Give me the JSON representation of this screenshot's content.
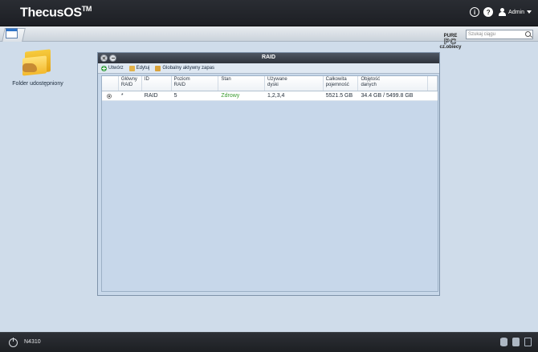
{
  "topbar": {
    "brand": "ThecusOS",
    "brand_mark": "TM",
    "user_label": "Admin",
    "info_glyph": "i",
    "help_glyph": "?"
  },
  "desktop": {
    "items": [
      {
        "label": "Folder udostępniony",
        "icon": "shared-folder-icon"
      }
    ]
  },
  "search": {
    "placeholder": "Szukaj ciągu"
  },
  "watermark": {
    "line1": "PURE",
    "line2": "PC",
    "line3": "cz.obiecy"
  },
  "raid_window": {
    "title": "RAID",
    "toolbar": {
      "create_label": "Utwórz",
      "edit_label": "Edytuj",
      "spare_label": "Globalny aktywny zapas"
    },
    "columns": [
      "",
      "Główny\nRAID",
      "ID",
      "Poziom\nRAID",
      "Stan",
      "Używane\ndyski",
      "Całkowita\npojemność",
      "Objętość\ndanych",
      ""
    ],
    "rows": [
      {
        "selected": true,
        "primary": "*",
        "id": "RAID",
        "level": "5",
        "status": "Zdrowy",
        "disks": "1,2,3,4",
        "capacity": "5521.5 GB",
        "data": "34.4 GB / 5499.8 GB"
      }
    ]
  },
  "bottombar": {
    "model": "N4310"
  },
  "colors": {
    "status_ok": "#3a9b2f",
    "topbar": "#2a2d33",
    "desktop": "#cfdcea"
  }
}
